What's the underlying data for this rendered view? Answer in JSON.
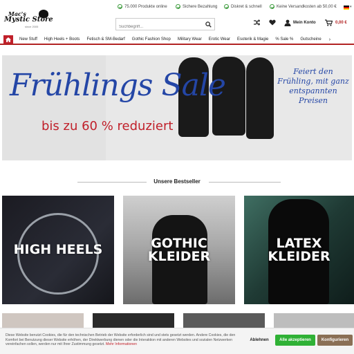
{
  "usp_bar": {
    "items": [
      "75.000 Produkte online",
      "Sichere Bezahlung",
      "Diskret & schnell",
      "Keine Versandkosten ab 50,00 €"
    ]
  },
  "header": {
    "logo_line1": "Mac's",
    "logo_line2": "Mystic Store",
    "logo_line3": "since 2005",
    "search_placeholder": "Suchbegriff...",
    "account_label": "Mein Konto",
    "cart_total": "0,00 €"
  },
  "nav": {
    "items": [
      "New Stuff",
      "High Heels + Boots",
      "Fetisch & SM-Bedarf",
      "Gothic Fashion Shop",
      "Military Wear",
      "Erotic Wear",
      "Esoterik & Magie",
      "% Sale %",
      "Gutscheine"
    ]
  },
  "banner": {
    "title": "Frühlings Sale",
    "subtitle": "bis zu 60 % reduziert",
    "right_text": "Feiert den Frühling, mit ganz entspannten Preisen"
  },
  "bestseller": {
    "heading": "Unsere Bestseller"
  },
  "tiles": [
    {
      "line1": "HIGH HEELS",
      "line2": ""
    },
    {
      "line1": "GOTHIC",
      "line2": "KLEIDER"
    },
    {
      "line1": "LATEX",
      "line2": "KLEIDER"
    }
  ],
  "cookie": {
    "text": "Diese Website benutzt Cookies, die für den technischen Betrieb der Website erforderlich sind und stets gesetzt werden. Andere Cookies, die den Komfort bei Benutzung dieser Website erhöhen, der Direktwerbung dienen oder die Interaktion mit anderen Websites und sozialen Netzwerken vereinfachen sollen, werden nur mit Ihrer Zustimmung gesetzt.",
    "more_link": "Mehr Informationen",
    "decline": "Ablehnen",
    "accept": "Alle akzeptieren",
    "configure": "Konfigurieren"
  },
  "colors": {
    "brand_red": "#c0202a",
    "accept_green": "#2fb135",
    "configure_brown": "#8a6f55",
    "banner_blue": "#2446a6"
  }
}
